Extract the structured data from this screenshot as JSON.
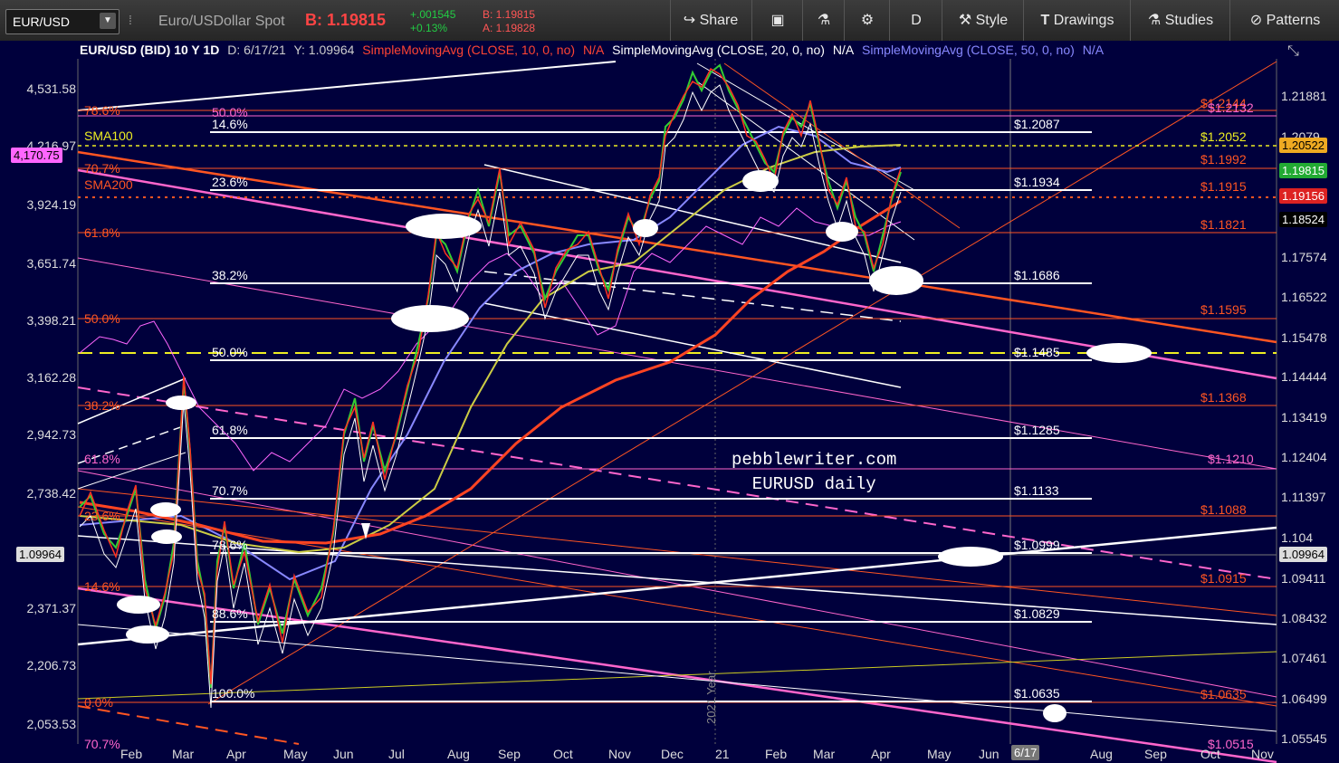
{
  "toolbar": {
    "symbol": "EUR/USD",
    "description": "Euro/USDollar Spot",
    "bid": "B: 1.19815",
    "change_abs": "+.001545",
    "change_pct": "+0.13%",
    "bid_small": "B: 1.19815",
    "ask_small": "A: 1.19828",
    "share": "Share",
    "period": "D",
    "style": "Style",
    "drawings": "Drawings",
    "studies": "Studies",
    "patterns": "Patterns"
  },
  "header": {
    "title": "EUR/USD (BID) 10 Y 1D",
    "date": "D: 6/17/21",
    "yvalue": "Y: 1.09964",
    "sma10": "SimpleMovingAvg (CLOSE, 10, 0, no)",
    "na1": "N/A",
    "sma20": "SimpleMovingAvg (CLOSE, 20, 0, no)",
    "na2": "N/A",
    "sma50": "SimpleMovingAvg (CLOSE, 50, 0, no)",
    "na3": "N/A"
  },
  "left_axis": [
    "4,531.58",
    "4,216.97",
    "3,924.19",
    "3,651.74",
    "3,398.21",
    "3,162.28",
    "2,942.73",
    "2,738.42",
    "2,371.37",
    "2,206.73",
    "2,053.53"
  ],
  "left_box": "4,170.75",
  "left_cross": "1.09964",
  "right_axis": [
    "1.21881",
    "1.2079",
    "1.17574",
    "1.16522",
    "1.15478",
    "1.14444",
    "1.13419",
    "1.12404",
    "1.11397",
    "1.104",
    "1.09411",
    "1.08432",
    "1.07461",
    "1.06499",
    "1.05545"
  ],
  "right_boxes": {
    "sma100": "1.20522",
    "last": "1.19815",
    "sma200": "1.19156",
    "cross": "1.18524",
    "y": "1.09964"
  },
  "x_axis": [
    "Feb",
    "Mar",
    "Apr",
    "May",
    "Jun",
    "Jul",
    "Aug",
    "Sep",
    "Oct",
    "Nov",
    "Dec",
    "21",
    "Feb",
    "Mar",
    "Apr",
    "May",
    "Jun",
    "Aug",
    "Sep",
    "Oct",
    "Nov"
  ],
  "x_cursor": "6/17",
  "year_marker": "2021 Year",
  "fib_orange": [
    "78.6%",
    "70.7%",
    "61.8%",
    "50.0%",
    "38.2%",
    "23.6%",
    "14.6%",
    "0.0%"
  ],
  "fib_white": [
    "14.6%",
    "23.6%",
    "38.2%",
    "50.0%",
    "61.8%",
    "70.7%",
    "78.6%",
    "88.6%",
    "100.0%"
  ],
  "sma_labels": [
    "SMA100",
    "SMA200"
  ],
  "pink_labels": [
    "50.0%",
    "61.8%",
    "70.7%"
  ],
  "white_prices": [
    "$1.2087",
    "$1.1934",
    "$1.1686",
    "$1.1485",
    "$1.1285",
    "$1.1133",
    "$1.0999",
    "$1.0829",
    "$1.0635"
  ],
  "orange_prices": [
    "$1.2144",
    "$1.1992",
    "$1.1915",
    "$1.1821",
    "$1.1595",
    "$1.1368",
    "$1.1088",
    "$1.0915",
    "$1.0635"
  ],
  "yellow_price": "$1.2052",
  "pink_prices": [
    "$1.2132",
    "$1.1210",
    "$1.0515"
  ],
  "watermark": [
    "pebblewriter.com",
    "EURUSD daily"
  ],
  "colors": {
    "bg": "#00003c",
    "orange": "#ff5522",
    "pink": "#ff66cc",
    "yellow": "#eeee22",
    "white": "#ffffff",
    "sma10": "#ff3322",
    "sma20": "#ffffff",
    "sma50": "#8888ff",
    "green": "#22cc44",
    "red": "#ff3333"
  }
}
